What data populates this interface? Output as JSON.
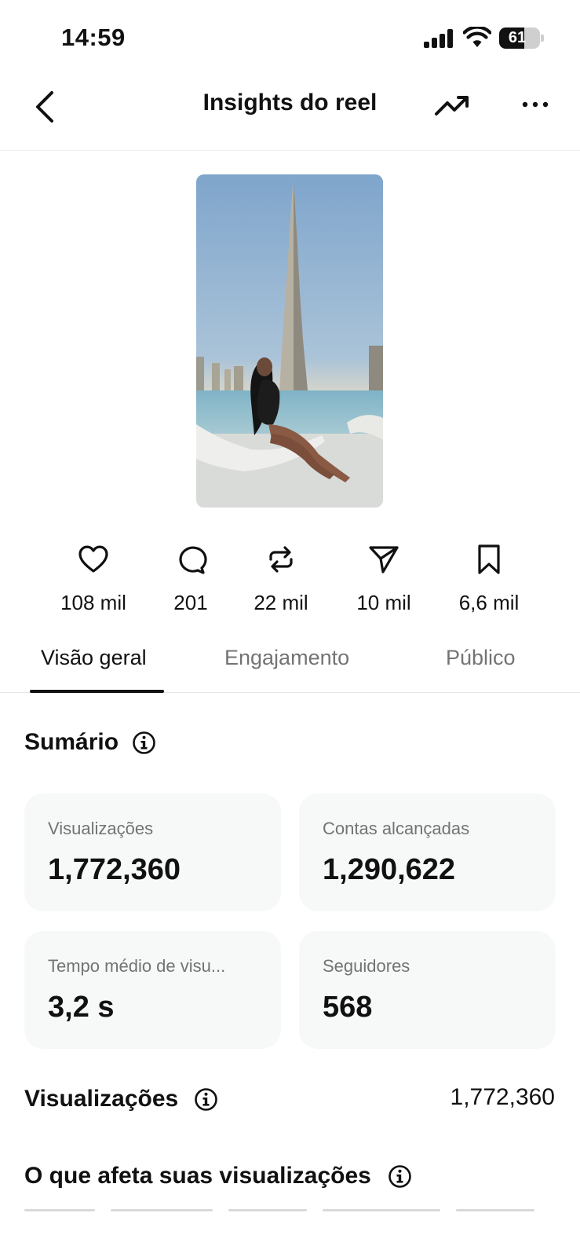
{
  "status_bar": {
    "time": "14:59",
    "battery": "61",
    "battery_level": 0.61
  },
  "header": {
    "title": "Insights do reel"
  },
  "stats": [
    {
      "icon": "heart-icon",
      "value": "108 mil"
    },
    {
      "icon": "comment-icon",
      "value": "201"
    },
    {
      "icon": "repost-icon",
      "value": "22 mil"
    },
    {
      "icon": "share-icon",
      "value": "10 mil"
    },
    {
      "icon": "bookmark-icon",
      "value": "6,6 mil"
    }
  ],
  "tabs": [
    {
      "label": "Visão geral",
      "active": true
    },
    {
      "label": "Engajamento",
      "active": false
    },
    {
      "label": "Público",
      "active": false
    }
  ],
  "summary": {
    "title": "Sumário",
    "cards": [
      {
        "label": "Visualizações",
        "value": "1,772,360"
      },
      {
        "label": "Contas alcançadas",
        "value": "1,290,622"
      },
      {
        "label": "Tempo médio de visu...",
        "value": "3,2 s"
      },
      {
        "label": "Seguidores",
        "value": "568"
      }
    ]
  },
  "views_section": {
    "title": "Visualizações",
    "value": "1,772,360"
  },
  "affects_section": {
    "title": "O que afeta suas visualizações"
  },
  "colors": {
    "text": "#111111",
    "secondary_text": "#737373",
    "card_bg": "#f7f8f8",
    "divider": "#efefef"
  }
}
